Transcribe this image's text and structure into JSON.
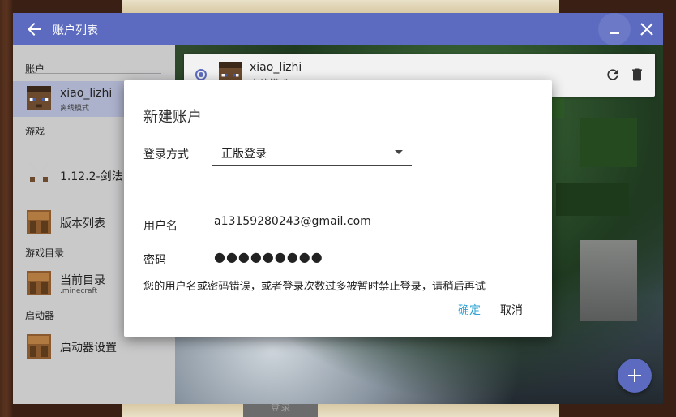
{
  "window": {
    "title": "账户列表"
  },
  "sidebar": {
    "sections": [
      {
        "label": "账户"
      },
      {
        "label": "游戏"
      },
      {
        "label": "游戏目录"
      },
      {
        "label": "启动器"
      }
    ],
    "items": [
      {
        "title": "xiao_lizhi",
        "subtitle": "离线模式"
      },
      {
        "title": "1.12.2-剑法",
        "subtitle": ""
      },
      {
        "title": "版本列表",
        "subtitle": ""
      },
      {
        "title": "当前目录",
        "subtitle": ".minecraft"
      },
      {
        "title": "启动器设置",
        "subtitle": ""
      }
    ]
  },
  "account_card": {
    "name": "xiao_lizhi",
    "subtitle": "离线模式"
  },
  "bottom_tab": {
    "label": "登录"
  },
  "dialog": {
    "title": "新建账户",
    "login_method_label": "登录方式",
    "login_method_value": "正版登录",
    "username_label": "用户名",
    "username_value": "a13159280243@gmail.com",
    "password_label": "密码",
    "password_masked": "●●●●●●●●●",
    "error_message": "您的用户名或密码错误，或者登录次数过多被暂时禁止登录，请稍后再试",
    "ok_label": "确定",
    "cancel_label": "取消"
  },
  "colors": {
    "accent": "#5c6bc0",
    "link": "#2ea3d4"
  },
  "icons": [
    "back-arrow-icon",
    "minimize-icon",
    "close-icon",
    "refresh-icon",
    "delete-icon",
    "add-icon",
    "steve-avatar-icon",
    "crossed-swords-icon",
    "crafting-table-icon"
  ]
}
